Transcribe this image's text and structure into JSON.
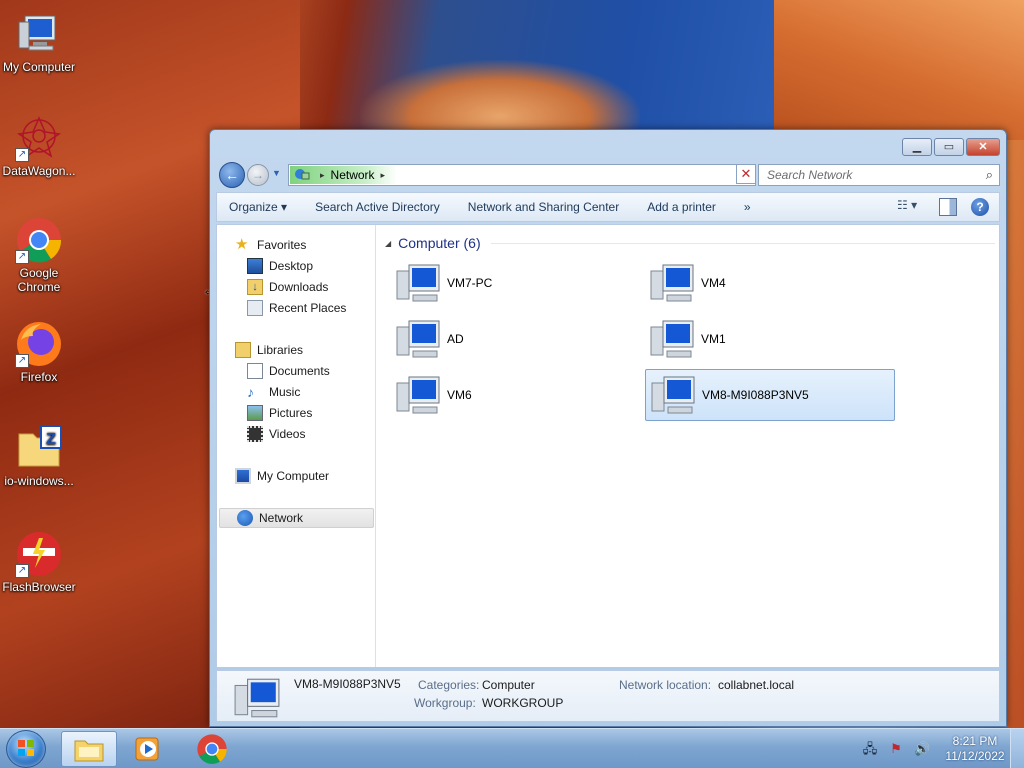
{
  "desktop": {
    "icons": [
      {
        "label": "My Computer",
        "icon": "computer-icon"
      },
      {
        "label": "DataWagon...",
        "icon": "datawagon-icon"
      },
      {
        "label": "Google Chrome",
        "icon": "chrome-icon"
      },
      {
        "label": "Firefox",
        "icon": "firefox-icon"
      },
      {
        "label": "io-windows...",
        "icon": "zip-folder-icon"
      },
      {
        "label": "FlashBrowser",
        "icon": "flashbrowser-icon"
      }
    ]
  },
  "window": {
    "address": {
      "crumb": "Network"
    },
    "search": {
      "placeholder": "Search Network"
    },
    "toolbar": {
      "items": [
        "Organize",
        "Search Active Directory",
        "Network and Sharing Center",
        "Add a printer"
      ],
      "more": "»"
    },
    "nav_pane": {
      "favorites": {
        "label": "Favorites",
        "items": [
          "Desktop",
          "Downloads",
          "Recent Places"
        ]
      },
      "libraries": {
        "label": "Libraries",
        "items": [
          "Documents",
          "Music",
          "Pictures",
          "Videos"
        ]
      },
      "computer": "My Computer",
      "network": "Network"
    },
    "group": {
      "title": "Computer (6)"
    },
    "computers": [
      "VM7-PC",
      "VM4",
      "AD",
      "VM1",
      "VM6",
      "VM8-M9I088P3NV5"
    ],
    "selected_computer": "VM8-M9I088P3NV5",
    "details": {
      "name": "VM8-M9I088P3NV5",
      "categories_label": "Categories:",
      "categories_value": "Computer",
      "workgroup_label": "Workgroup:",
      "workgroup_value": "WORKGROUP",
      "network_location_label": "Network location:",
      "network_location_value": "collabnet.local"
    }
  },
  "taskbar": {
    "pinned": [
      "explorer-icon",
      "media-player-icon",
      "chrome-icon"
    ],
    "clock": {
      "time": "8:21 PM",
      "date": "11/12/2022"
    }
  },
  "colors": {
    "accent": "#1e3287",
    "selection": "#cde3fa",
    "taskbar": "#7fa6d1"
  }
}
